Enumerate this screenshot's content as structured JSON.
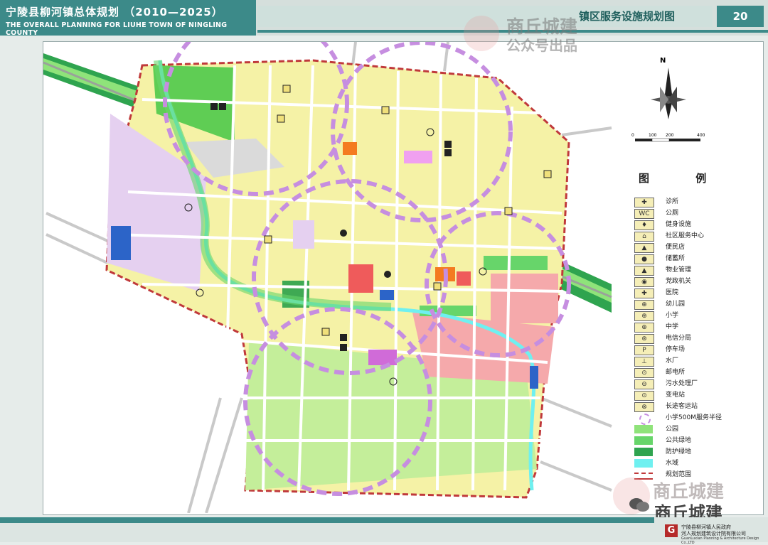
{
  "header": {
    "title_cn": "宁陵县柳河镇总体规划 （2010—2025）",
    "title_en": "THE OVERALL PLANNING FOR LIUHE TOWN OF NINGLING COUNTY",
    "sheet_title": "镇区服务设施规划图",
    "page_number": "20"
  },
  "watermark": {
    "line1": "商丘城建",
    "line2": "公众号出品",
    "bottom_line1": "商丘城建",
    "bottom_line2": "商丘城建"
  },
  "map": {
    "north_label": "N",
    "scale_labels": [
      "0",
      "100",
      "200",
      "400"
    ]
  },
  "legend": {
    "title": "图 例",
    "items": [
      {
        "label": "诊所",
        "symbol": "clinic-icon",
        "glyph": "✚"
      },
      {
        "label": "公厕",
        "symbol": "toilet-icon",
        "glyph": "WC"
      },
      {
        "label": "健身设施",
        "symbol": "fitness-icon",
        "glyph": "♦"
      },
      {
        "label": "社区服务中心",
        "symbol": "community-center-icon",
        "glyph": "⌂"
      },
      {
        "label": "便民店",
        "symbol": "shop-icon",
        "glyph": "▲"
      },
      {
        "label": "储蓄所",
        "symbol": "bank-icon",
        "glyph": "●"
      },
      {
        "label": "物业管理",
        "symbol": "property-icon",
        "glyph": "▲"
      },
      {
        "label": "党政机关",
        "symbol": "government-icon",
        "glyph": "◉"
      },
      {
        "label": "医院",
        "symbol": "hospital-icon",
        "glyph": "✚"
      },
      {
        "label": "幼儿园",
        "symbol": "kindergarten-icon",
        "glyph": "⊕"
      },
      {
        "label": "小学",
        "symbol": "primary-school-icon",
        "glyph": "⊕"
      },
      {
        "label": "中学",
        "symbol": "middle-school-icon",
        "glyph": "⊕"
      },
      {
        "label": "电信分局",
        "symbol": "telecom-icon",
        "glyph": "⊛"
      },
      {
        "label": "停车场",
        "symbol": "parking-icon",
        "glyph": "P"
      },
      {
        "label": "水厂",
        "symbol": "waterworks-icon",
        "glyph": "⊥"
      },
      {
        "label": "邮电所",
        "symbol": "post-office-icon",
        "glyph": "⊙"
      },
      {
        "label": "污水处理厂",
        "symbol": "sewage-plant-icon",
        "glyph": "⊖"
      },
      {
        "label": "变电站",
        "symbol": "substation-icon",
        "glyph": "⊙"
      },
      {
        "label": "长途客运站",
        "symbol": "bus-station-icon",
        "glyph": "⊗"
      },
      {
        "label": "小学500M服务半径",
        "symbol": "service-radius-icon",
        "glyph": ""
      },
      {
        "label": "公园",
        "symbol": "park-swatch",
        "glyph": ""
      },
      {
        "label": "公共绿地",
        "symbol": "public-green-swatch",
        "glyph": ""
      },
      {
        "label": "防护绿地",
        "symbol": "protective-green-swatch",
        "glyph": ""
      },
      {
        "label": "水域",
        "symbol": "water-swatch",
        "glyph": ""
      },
      {
        "label": "规划范围",
        "symbol": "planning-boundary-swatch",
        "glyph": ""
      }
    ]
  },
  "colors": {
    "header_teal": "#3c8a89",
    "residential": "#f5f2a6",
    "green_park": "#8fe37a",
    "public_green": "#67d56a",
    "protective_green": "#2fa44f",
    "water": "#6ff0f0",
    "commercial_pink": "#f5a9ab",
    "admin_purple": "#e5d0f0",
    "industrial": "#d3b1f3",
    "service_radius": "#c68ee0",
    "boundary": "#c0393b",
    "red_facility": "#ef5b5b",
    "blue_facility": "#2c64c8",
    "orange_facility": "#f47b20",
    "magenta_facility": "#d06bd8"
  },
  "footer": {
    "org_line1": "宁陵县柳河镇人民政府",
    "org_line2": "河人规划建筑设计院有限公司",
    "org_line3": "GuanLuxian Planning & Architecture Design Co.,LTD",
    "logo_glyph": "G"
  }
}
